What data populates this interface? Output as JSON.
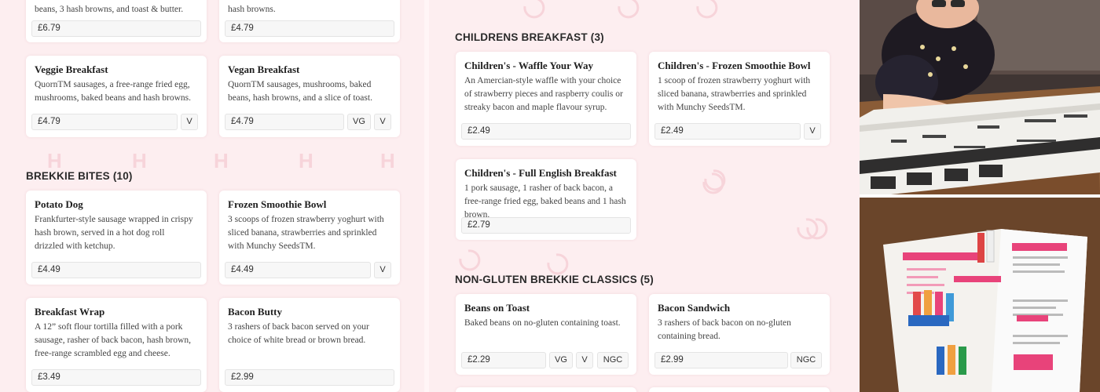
{
  "left": {
    "top_cards": [
      {
        "desc": "beans, 3 hash browns, and toast & butter.",
        "price": "£6.79",
        "badges": []
      },
      {
        "desc": "hash browns.",
        "price": "£4.79",
        "badges": []
      },
      {
        "name": "Veggie Breakfast",
        "desc": "QuornTM sausages, a free-range fried egg, mushrooms, baked beans and hash browns.",
        "price": "£4.79",
        "badges": [
          "V"
        ]
      },
      {
        "name": "Vegan Breakfast",
        "desc": "QuornTM sausages, mushrooms, baked beans, hash browns, and a slice of toast.",
        "price": "£4.79",
        "badges": [
          "VG",
          "V"
        ]
      }
    ],
    "brekkie_bites": {
      "title": "BREKKIE BITES (10)",
      "items": [
        {
          "name": "Potato Dog",
          "desc": "Frankfurter-style sausage wrapped in crispy hash brown, served in a hot dog roll drizzled with ketchup.",
          "price": "£4.49",
          "badges": []
        },
        {
          "name": "Frozen Smoothie Bowl",
          "desc": "3 scoops of frozen strawberry yoghurt with sliced banana, strawberries and sprinkled with Munchy SeedsTM.",
          "price": "£4.49",
          "badges": [
            "V"
          ]
        },
        {
          "name": "Breakfast Wrap",
          "desc": "A 12” soft flour tortilla filled with a pork sausage, rasher of back bacon, hash brown, free-range scrambled egg and cheese.",
          "price": "£3.49",
          "badges": []
        },
        {
          "name": "Bacon Butty",
          "desc": "3 rashers of back bacon served on your choice of white bread or brown bread.",
          "price": "£2.99",
          "badges": []
        }
      ]
    }
  },
  "middle": {
    "childrens": {
      "title": "CHILDRENS BREAKFAST (3)",
      "items": [
        {
          "name": "Children's - Waffle Your Way",
          "desc": "An Amercian-style waffle with your choice of strawberry pieces and raspberry coulis or streaky bacon and maple flavour syrup.",
          "price": "£2.49",
          "badges": []
        },
        {
          "name": "Children's - Frozen Smoothie Bowl",
          "desc": "1 scoop of frozen strawberry yoghurt with sliced banana, strawberries and sprinkled with Munchy SeedsTM.",
          "price": "£2.49",
          "badges": [
            "V"
          ]
        },
        {
          "name": "Children's - Full English Breakfast",
          "desc": "1 pork sausage, 1 rasher of back bacon, a free-range fried egg, baked beans and 1 hash brown.",
          "price": "£2.79",
          "badges": []
        }
      ]
    },
    "non_gluten": {
      "title": "NON-GLUTEN BREKKIE CLASSICS (5)",
      "items": [
        {
          "name": "Beans on Toast",
          "desc": "Baked beans on no-gluten containing toast.",
          "price": "£2.29",
          "badges": [
            "VG",
            "V",
            "NGC"
          ]
        },
        {
          "name": "Bacon Sandwich",
          "desc": "3 rashers of back bacon on no-gluten containing bread.",
          "price": "£2.99",
          "badges": [
            "NGC"
          ]
        }
      ]
    }
  },
  "photos": {
    "photo1_icon": "child-with-menu-photo",
    "photo2_icon": "drinks-menu-photo"
  },
  "colors": {
    "page_bg": "#fdeef0",
    "accent_pink": "#f7d4da",
    "card_bg": "#ffffff"
  }
}
